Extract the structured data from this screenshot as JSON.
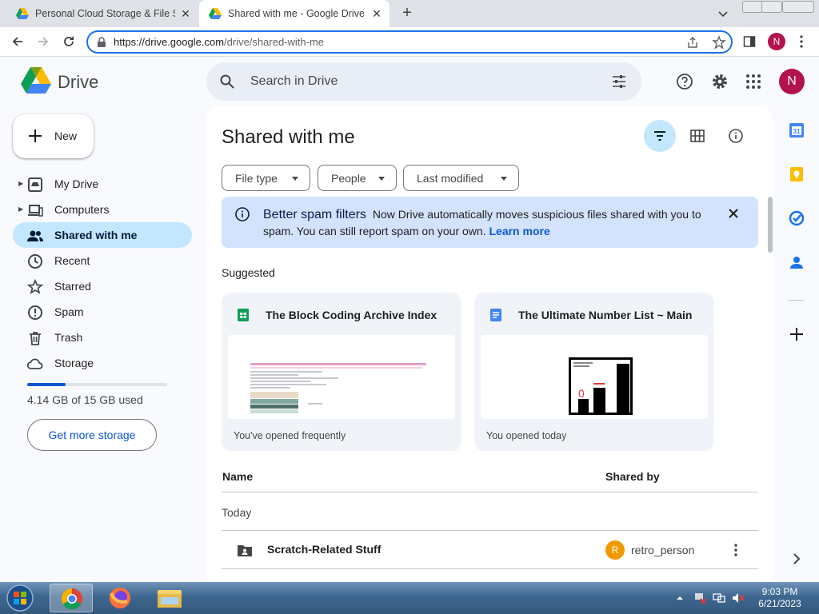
{
  "browser": {
    "tabs": [
      {
        "title": "Personal Cloud Storage & File Sharing Platform - Google",
        "active": false
      },
      {
        "title": "Shared with me - Google Drive",
        "active": true
      }
    ],
    "url_host": "https://drive.google.com",
    "url_path": "/drive/shared-with-me",
    "profile_initial": "N"
  },
  "drive": {
    "logo_text": "Drive",
    "search_placeholder": "Search in Drive",
    "avatar_initial": "N",
    "new_label": "New",
    "nav": [
      {
        "label": "My Drive",
        "icon": "my-drive-icon",
        "active": false
      },
      {
        "label": "Computers",
        "icon": "computers-icon",
        "active": false
      },
      {
        "label": "Shared with me",
        "icon": "shared-icon",
        "active": true
      },
      {
        "label": "Recent",
        "icon": "clock-icon",
        "active": false
      },
      {
        "label": "Starred",
        "icon": "star-icon",
        "active": false
      },
      {
        "label": "Spam",
        "icon": "spam-icon",
        "active": false
      },
      {
        "label": "Trash",
        "icon": "trash-icon",
        "active": false
      },
      {
        "label": "Storage",
        "icon": "cloud-icon",
        "active": false
      }
    ],
    "storage": {
      "used_fraction": 0.276,
      "text": "4.14 GB of 15 GB used",
      "button": "Get more storage"
    },
    "page_title": "Shared with me",
    "filters": {
      "file_type": "File type",
      "people": "People",
      "last_modified": "Last modified"
    },
    "banner": {
      "title": "Better spam filters",
      "body": "Now Drive automatically moves suspicious files shared with you to spam. You can still report spam on your own.",
      "link": "Learn more"
    },
    "suggested_label": "Suggested",
    "suggested": [
      {
        "title": "The Block Coding Archive Index",
        "type": "sheets",
        "subtitle": "You've opened frequently"
      },
      {
        "title": "The Ultimate Number List ~ Main",
        "type": "docs",
        "subtitle": "You opened today",
        "thumb_zero": "0"
      }
    ],
    "list": {
      "col_name": "Name",
      "col_shared_by": "Shared by",
      "group": "Today",
      "rows": [
        {
          "name": "Scratch-Related Stuff",
          "owner_initial": "R",
          "owner": "retro_person"
        }
      ]
    }
  },
  "taskbar": {
    "time": "9:03 PM",
    "date": "6/21/2023"
  },
  "colors": {
    "accent": "#0b57d0",
    "active_nav": "#c2e7ff",
    "avatar": "#b3124b",
    "owner_avatar": "#f29900"
  }
}
